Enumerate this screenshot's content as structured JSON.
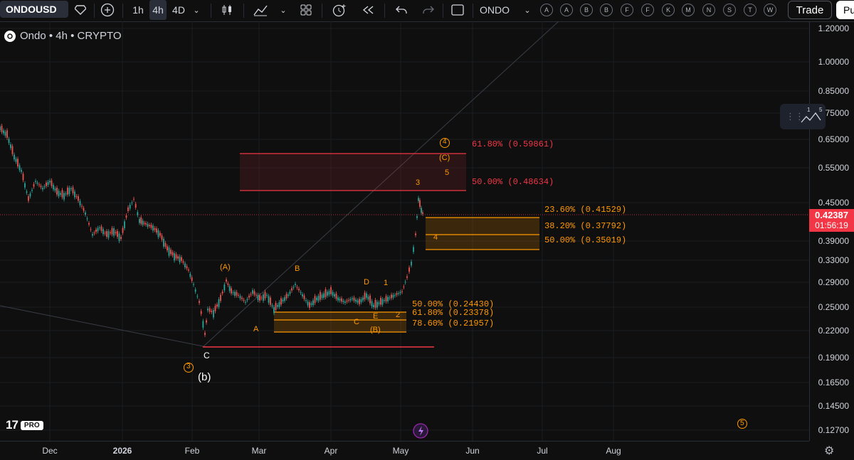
{
  "toolbar": {
    "symbol": "ONDOUSD",
    "timeframes": [
      "1h",
      "4h",
      "4D"
    ],
    "active_timeframe": "4h",
    "compare_symbol": "ONDO",
    "alert_letters": [
      "A",
      "A",
      "B",
      "B",
      "F",
      "F",
      "K",
      "M",
      "N",
      "S",
      "T",
      "W"
    ],
    "trade_label": "Trade",
    "publish_label": "Pu"
  },
  "legend": {
    "title": "Ondo • 4h • CRYPTO"
  },
  "price_axis": {
    "ticks": [
      "1.20000",
      "1.00000",
      "0.85000",
      "0.75000",
      "0.65000",
      "0.55000",
      "0.45000",
      "0.39000",
      "0.33000",
      "0.29000",
      "0.25000",
      "0.22000",
      "0.19000",
      "0.16500",
      "0.14500",
      "0.12700"
    ],
    "current_price": "0.42387",
    "countdown": "01:56:19"
  },
  "time_axis": {
    "ticks": [
      "Dec",
      "2026",
      "Feb",
      "Mar",
      "Apr",
      "May",
      "Jun",
      "Jul",
      "Aug"
    ]
  },
  "fib_upper": [
    {
      "text": "61.80% (0.59861)",
      "color": "#f23645"
    },
    {
      "text": "50.00% (0.48634)",
      "color": "#f23645"
    }
  ],
  "fib_mid": [
    {
      "text": "23.60% (0.41529)",
      "color": "#ff9800"
    },
    {
      "text": "38.20% (0.37792)",
      "color": "#ff9800"
    },
    {
      "text": "50.00% (0.35019)",
      "color": "#ff9800"
    }
  ],
  "fib_low": [
    {
      "text": "50.00% (0.24430)",
      "color": "#ff9800"
    },
    {
      "text": "61.80% (0.23378)",
      "color": "#ff9800"
    },
    {
      "text": "78.60% (0.21957)",
      "color": "#ff9800"
    }
  ],
  "wave_labels": {
    "A_paren": "(A)",
    "B": "B",
    "A": "A",
    "C": "C",
    "D": "D",
    "E": "E",
    "B_paren": "(B)",
    "one": "1",
    "two": "2",
    "three": "3",
    "four": "4",
    "five": "5",
    "C_paren": "(C)",
    "circle3": "3",
    "circle4": "4",
    "circle5": "5",
    "C_low": "C",
    "b_paren": "(b)"
  },
  "widget": {
    "labels": [
      "1",
      "5"
    ]
  },
  "branding": {
    "pro": "PRO"
  },
  "colors": {
    "background": "#0f0f0f",
    "up": "#26a69a",
    "down": "#ef5350",
    "accent": "#ff9800",
    "red": "#f23645"
  }
}
